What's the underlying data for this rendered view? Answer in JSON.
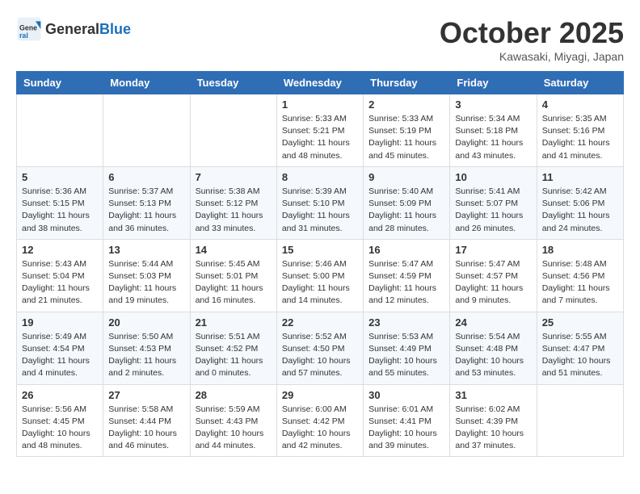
{
  "header": {
    "logo_general": "General",
    "logo_blue": "Blue",
    "month_title": "October 2025",
    "location": "Kawasaki, Miyagi, Japan"
  },
  "weekdays": [
    "Sunday",
    "Monday",
    "Tuesday",
    "Wednesday",
    "Thursday",
    "Friday",
    "Saturday"
  ],
  "weeks": [
    [
      {
        "day": "",
        "info": ""
      },
      {
        "day": "",
        "info": ""
      },
      {
        "day": "",
        "info": ""
      },
      {
        "day": "1",
        "info": "Sunrise: 5:33 AM\nSunset: 5:21 PM\nDaylight: 11 hours\nand 48 minutes."
      },
      {
        "day": "2",
        "info": "Sunrise: 5:33 AM\nSunset: 5:19 PM\nDaylight: 11 hours\nand 45 minutes."
      },
      {
        "day": "3",
        "info": "Sunrise: 5:34 AM\nSunset: 5:18 PM\nDaylight: 11 hours\nand 43 minutes."
      },
      {
        "day": "4",
        "info": "Sunrise: 5:35 AM\nSunset: 5:16 PM\nDaylight: 11 hours\nand 41 minutes."
      }
    ],
    [
      {
        "day": "5",
        "info": "Sunrise: 5:36 AM\nSunset: 5:15 PM\nDaylight: 11 hours\nand 38 minutes."
      },
      {
        "day": "6",
        "info": "Sunrise: 5:37 AM\nSunset: 5:13 PM\nDaylight: 11 hours\nand 36 minutes."
      },
      {
        "day": "7",
        "info": "Sunrise: 5:38 AM\nSunset: 5:12 PM\nDaylight: 11 hours\nand 33 minutes."
      },
      {
        "day": "8",
        "info": "Sunrise: 5:39 AM\nSunset: 5:10 PM\nDaylight: 11 hours\nand 31 minutes."
      },
      {
        "day": "9",
        "info": "Sunrise: 5:40 AM\nSunset: 5:09 PM\nDaylight: 11 hours\nand 28 minutes."
      },
      {
        "day": "10",
        "info": "Sunrise: 5:41 AM\nSunset: 5:07 PM\nDaylight: 11 hours\nand 26 minutes."
      },
      {
        "day": "11",
        "info": "Sunrise: 5:42 AM\nSunset: 5:06 PM\nDaylight: 11 hours\nand 24 minutes."
      }
    ],
    [
      {
        "day": "12",
        "info": "Sunrise: 5:43 AM\nSunset: 5:04 PM\nDaylight: 11 hours\nand 21 minutes."
      },
      {
        "day": "13",
        "info": "Sunrise: 5:44 AM\nSunset: 5:03 PM\nDaylight: 11 hours\nand 19 minutes."
      },
      {
        "day": "14",
        "info": "Sunrise: 5:45 AM\nSunset: 5:01 PM\nDaylight: 11 hours\nand 16 minutes."
      },
      {
        "day": "15",
        "info": "Sunrise: 5:46 AM\nSunset: 5:00 PM\nDaylight: 11 hours\nand 14 minutes."
      },
      {
        "day": "16",
        "info": "Sunrise: 5:47 AM\nSunset: 4:59 PM\nDaylight: 11 hours\nand 12 minutes."
      },
      {
        "day": "17",
        "info": "Sunrise: 5:47 AM\nSunset: 4:57 PM\nDaylight: 11 hours\nand 9 minutes."
      },
      {
        "day": "18",
        "info": "Sunrise: 5:48 AM\nSunset: 4:56 PM\nDaylight: 11 hours\nand 7 minutes."
      }
    ],
    [
      {
        "day": "19",
        "info": "Sunrise: 5:49 AM\nSunset: 4:54 PM\nDaylight: 11 hours\nand 4 minutes."
      },
      {
        "day": "20",
        "info": "Sunrise: 5:50 AM\nSunset: 4:53 PM\nDaylight: 11 hours\nand 2 minutes."
      },
      {
        "day": "21",
        "info": "Sunrise: 5:51 AM\nSunset: 4:52 PM\nDaylight: 11 hours\nand 0 minutes."
      },
      {
        "day": "22",
        "info": "Sunrise: 5:52 AM\nSunset: 4:50 PM\nDaylight: 10 hours\nand 57 minutes."
      },
      {
        "day": "23",
        "info": "Sunrise: 5:53 AM\nSunset: 4:49 PM\nDaylight: 10 hours\nand 55 minutes."
      },
      {
        "day": "24",
        "info": "Sunrise: 5:54 AM\nSunset: 4:48 PM\nDaylight: 10 hours\nand 53 minutes."
      },
      {
        "day": "25",
        "info": "Sunrise: 5:55 AM\nSunset: 4:47 PM\nDaylight: 10 hours\nand 51 minutes."
      }
    ],
    [
      {
        "day": "26",
        "info": "Sunrise: 5:56 AM\nSunset: 4:45 PM\nDaylight: 10 hours\nand 48 minutes."
      },
      {
        "day": "27",
        "info": "Sunrise: 5:58 AM\nSunset: 4:44 PM\nDaylight: 10 hours\nand 46 minutes."
      },
      {
        "day": "28",
        "info": "Sunrise: 5:59 AM\nSunset: 4:43 PM\nDaylight: 10 hours\nand 44 minutes."
      },
      {
        "day": "29",
        "info": "Sunrise: 6:00 AM\nSunset: 4:42 PM\nDaylight: 10 hours\nand 42 minutes."
      },
      {
        "day": "30",
        "info": "Sunrise: 6:01 AM\nSunset: 4:41 PM\nDaylight: 10 hours\nand 39 minutes."
      },
      {
        "day": "31",
        "info": "Sunrise: 6:02 AM\nSunset: 4:39 PM\nDaylight: 10 hours\nand 37 minutes."
      },
      {
        "day": "",
        "info": ""
      }
    ]
  ]
}
